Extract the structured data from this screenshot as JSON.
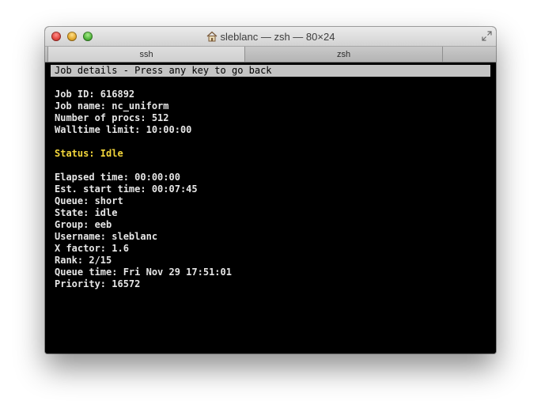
{
  "window": {
    "title": "sleblanc — zsh — 80×24"
  },
  "tabs": [
    {
      "label": "ssh",
      "active": true
    },
    {
      "label": "zsh",
      "active": false
    }
  ],
  "terminal": {
    "header": "Job details - Press any key to go back",
    "job_id": "Job ID: 616892",
    "job_name": "Job name: nc_uniform",
    "num_procs": "Number of procs: 512",
    "walltime": "Walltime limit: 10:00:00",
    "status": "Status: Idle",
    "elapsed": "Elapsed time: 00:00:00",
    "est_start": "Est. start time: 00:07:45",
    "queue": "Queue: short",
    "state": "State: idle",
    "group": "Group: eeb",
    "username": "Username: sleblanc",
    "x_factor": "X factor: 1.6",
    "rank": "Rank: 2/15",
    "queue_time": "Queue time: Fri Nov 29 17:51:01",
    "priority": "Priority: 16572"
  },
  "colors": {
    "status_text": "#f3d63b",
    "terminal_bg": "#000000",
    "terminal_fg": "#e6e6e6",
    "header_bg": "#c4c4c4"
  },
  "icons": [
    "close-icon",
    "minimize-icon",
    "zoom-icon",
    "home-icon",
    "fullscreen-icon"
  ]
}
